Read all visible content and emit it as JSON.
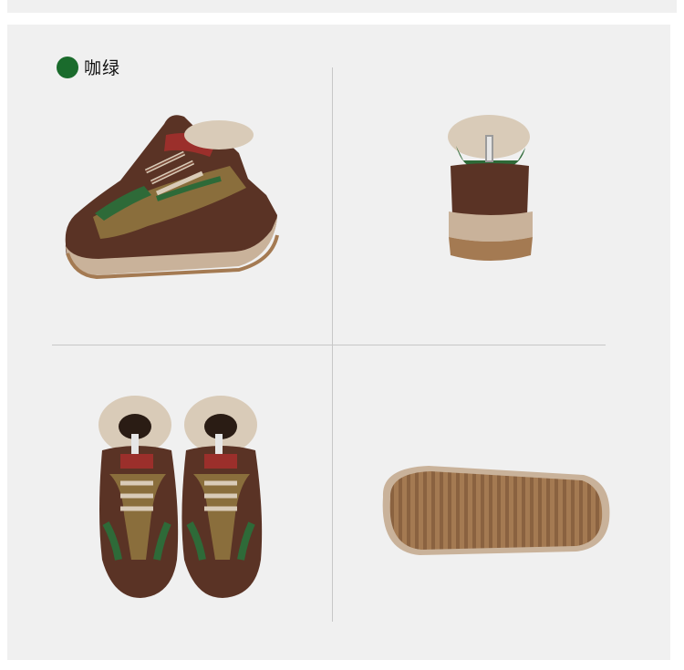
{
  "color_option": {
    "swatch_color": "#1a6b2c",
    "label": "咖绿"
  },
  "views": [
    {
      "name": "side-view",
      "icon": "sneaker-side"
    },
    {
      "name": "back-view",
      "icon": "sneaker-back"
    },
    {
      "name": "top-view-pair",
      "icon": "sneaker-pair-top"
    },
    {
      "name": "sole-view",
      "icon": "sneaker-sole"
    }
  ],
  "palette": {
    "leather_brown": "#5a3325",
    "khaki": "#8a6e3c",
    "green": "#2e6a38",
    "red": "#9b2f2b",
    "fur": "#d9cbb8",
    "sole": "#a47a52",
    "midsole": "#c9b29a"
  }
}
